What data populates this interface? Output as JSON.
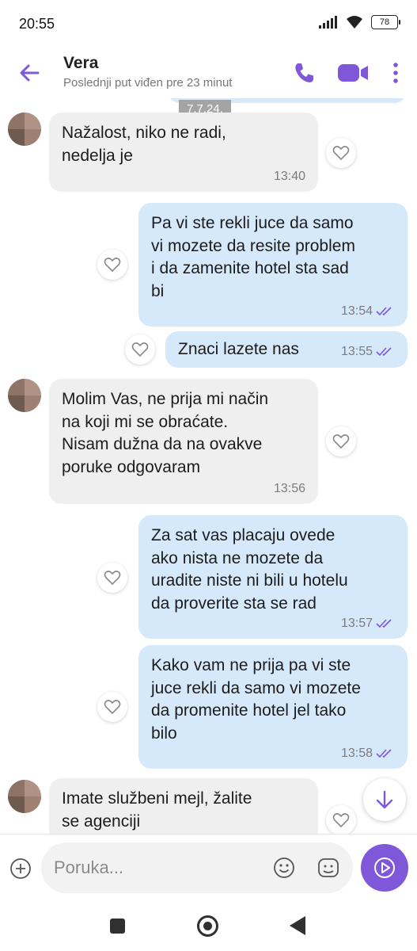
{
  "status_bar": {
    "time": "20:55",
    "battery": "78"
  },
  "header": {
    "contact_name": "Vera",
    "last_seen": "Poslednji put viđen pre 23 minut"
  },
  "chat": {
    "date_label": "7.7.24.",
    "messages": [
      {
        "direction": "incoming",
        "text": "Nažalost, niko ne radi,\nnedelja je",
        "time": "13:40"
      },
      {
        "direction": "outgoing",
        "text": "Pa vi ste rekli juce da samo\nvi mozete da resite problem\ni da zamenite hotel sta sad\nbi",
        "time": "13:54"
      },
      {
        "direction": "outgoing",
        "text": "Znaci lazete nas",
        "time": "13:55"
      },
      {
        "direction": "incoming",
        "text": "Molim Vas, ne prija mi način\nna koji mi se obraćate.\nNisam dužna da na ovakve\nporuke odgovaram",
        "time": "13:56"
      },
      {
        "direction": "outgoing",
        "text": "Za sat vas placaju ovede\nako nista ne mozete da\nuradite niste ni bili u hotelu\nda proverite sta se rad",
        "time": "13:57"
      },
      {
        "direction": "outgoing",
        "text": "Kako vam ne prija pa vi ste\njuce rekli da samo vi mozete\nda promenite hotel jel tako\nbilo",
        "time": "13:58"
      },
      {
        "direction": "incoming",
        "text": "Imate službeni mejl, žalite\nse agenciji",
        "time": ""
      }
    ]
  },
  "composer": {
    "placeholder": "Poruka..."
  },
  "colors": {
    "accent": "#7e58d8",
    "outgoing_bubble": "#d6e9fb",
    "incoming_bubble": "#efefef"
  }
}
